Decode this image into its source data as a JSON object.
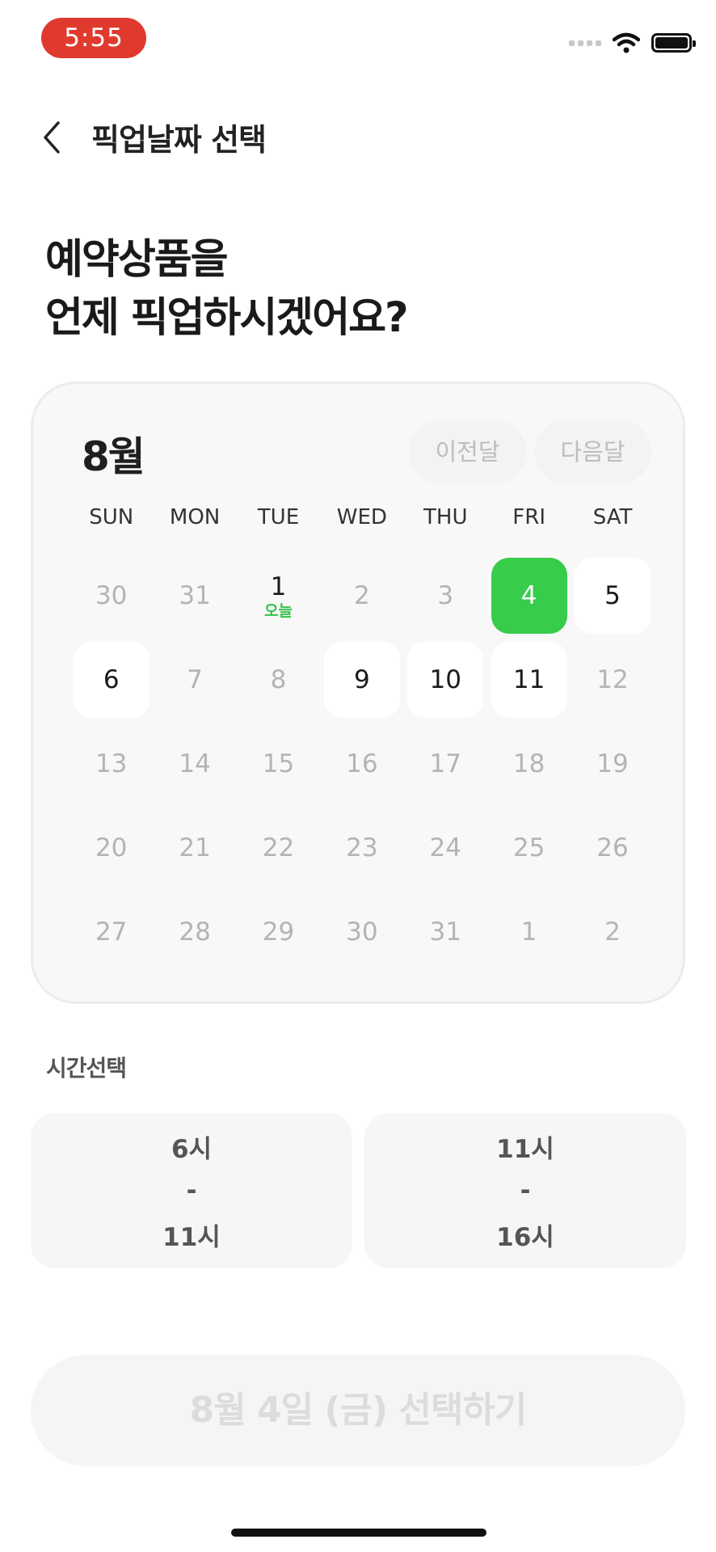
{
  "status_bar": {
    "time": "5:55",
    "wifi_icon": "wifi-icon",
    "battery_icon": "battery-icon"
  },
  "header": {
    "title": "픽업날짜 선택",
    "back_icon": "chevron-left-icon"
  },
  "headline": {
    "line1": "예약상품을",
    "line2": "언제 픽업하시겠어요?"
  },
  "calendar": {
    "month": "8월",
    "prev_label": "이전달",
    "next_label": "다음달",
    "weekdays": [
      "SUN",
      "MON",
      "TUE",
      "WED",
      "THU",
      "FRI",
      "SAT"
    ],
    "today_tag": "오늘",
    "days": [
      {
        "label": "30",
        "state": "disabled"
      },
      {
        "label": "31",
        "state": "disabled"
      },
      {
        "label": "1",
        "state": "today"
      },
      {
        "label": "2",
        "state": "disabled"
      },
      {
        "label": "3",
        "state": "disabled"
      },
      {
        "label": "4",
        "state": "selected"
      },
      {
        "label": "5",
        "state": "available"
      },
      {
        "label": "6",
        "state": "available"
      },
      {
        "label": "7",
        "state": "disabled"
      },
      {
        "label": "8",
        "state": "disabled"
      },
      {
        "label": "9",
        "state": "available"
      },
      {
        "label": "10",
        "state": "available"
      },
      {
        "label": "11",
        "state": "available"
      },
      {
        "label": "12",
        "state": "disabled"
      },
      {
        "label": "13",
        "state": "disabled"
      },
      {
        "label": "14",
        "state": "disabled"
      },
      {
        "label": "15",
        "state": "disabled"
      },
      {
        "label": "16",
        "state": "disabled"
      },
      {
        "label": "17",
        "state": "disabled"
      },
      {
        "label": "18",
        "state": "disabled"
      },
      {
        "label": "19",
        "state": "disabled"
      },
      {
        "label": "20",
        "state": "disabled"
      },
      {
        "label": "21",
        "state": "disabled"
      },
      {
        "label": "22",
        "state": "disabled"
      },
      {
        "label": "23",
        "state": "disabled"
      },
      {
        "label": "24",
        "state": "disabled"
      },
      {
        "label": "25",
        "state": "disabled"
      },
      {
        "label": "26",
        "state": "disabled"
      },
      {
        "label": "27",
        "state": "disabled"
      },
      {
        "label": "28",
        "state": "disabled"
      },
      {
        "label": "29",
        "state": "disabled"
      },
      {
        "label": "30",
        "state": "disabled"
      },
      {
        "label": "31",
        "state": "disabled"
      },
      {
        "label": "1",
        "state": "disabled"
      },
      {
        "label": "2",
        "state": "disabled"
      }
    ]
  },
  "time_selection": {
    "label": "시간선택",
    "slots": [
      {
        "start": "6시",
        "dash": "-",
        "end": "11시"
      },
      {
        "start": "11시",
        "dash": "-",
        "end": "16시"
      }
    ]
  },
  "confirm_button": {
    "label": "8월 4일 (금) 선택하기"
  },
  "colors": {
    "accent": "#37cc4a",
    "status_time_bg": "#e03a2f",
    "disabled_text": "#b4b4b4"
  }
}
